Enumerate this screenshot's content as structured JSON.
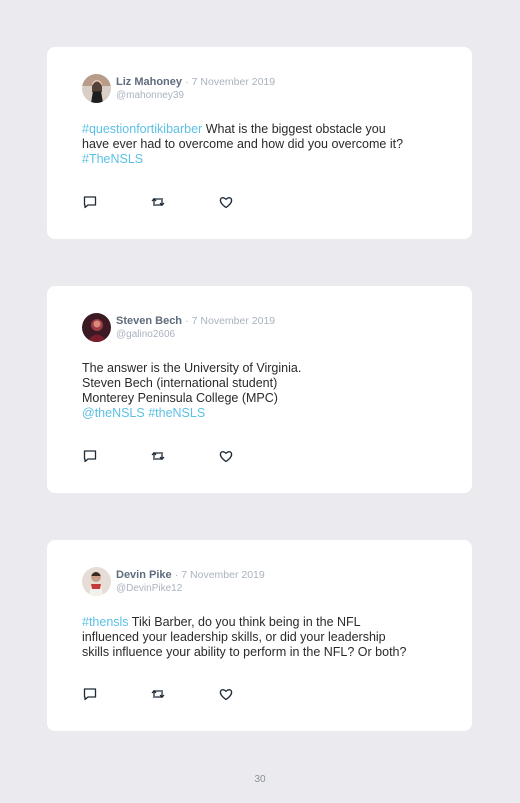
{
  "tweets": [
    {
      "name": "Liz Mahoney",
      "date": "7 November 2019",
      "handle": "@mahonney39",
      "lines": [
        [
          {
            "t": "#questionfortikibarber",
            "tag": true
          },
          {
            "t": " What is the biggest obstacle you",
            "tag": false
          }
        ],
        [
          {
            "t": "have ever had to overcome and how did you overcome it?",
            "tag": false
          }
        ],
        [
          {
            "t": "#TheNSLS",
            "tag": true
          }
        ]
      ]
    },
    {
      "name": "Steven Bech",
      "date": "7 November 2019",
      "handle": "@galino2606",
      "lines": [
        [
          {
            "t": "The answer is the University of Virginia.",
            "tag": false
          }
        ],
        [
          {
            "t": "Steven Bech (international student)",
            "tag": false
          }
        ],
        [
          {
            "t": "Monterey Peninsula College (MPC)",
            "tag": false
          }
        ],
        [
          {
            "t": "@theNSLS #theNSLS",
            "tag": true
          }
        ]
      ]
    },
    {
      "name": "Devin Pike",
      "date": "7 November 2019",
      "handle": "@DevinPike12",
      "lines": [
        [
          {
            "t": "#thensls",
            "tag": true
          },
          {
            "t": " Tiki Barber, do you think being in the NFL",
            "tag": false
          }
        ],
        [
          {
            "t": "influenced your leadership skills, or did your leadership",
            "tag": false
          }
        ],
        [
          {
            "t": "skills influence your ability to perform in the NFL? Or both?",
            "tag": false
          }
        ]
      ]
    }
  ],
  "separator": "·",
  "page_number": "30",
  "icons": [
    "reply-icon",
    "retweet-icon",
    "like-icon"
  ],
  "colors": {
    "hashtag": "#5bc0e6",
    "name": "#5f6c7d",
    "meta": "#aab3bf",
    "background": "#ebebef"
  }
}
